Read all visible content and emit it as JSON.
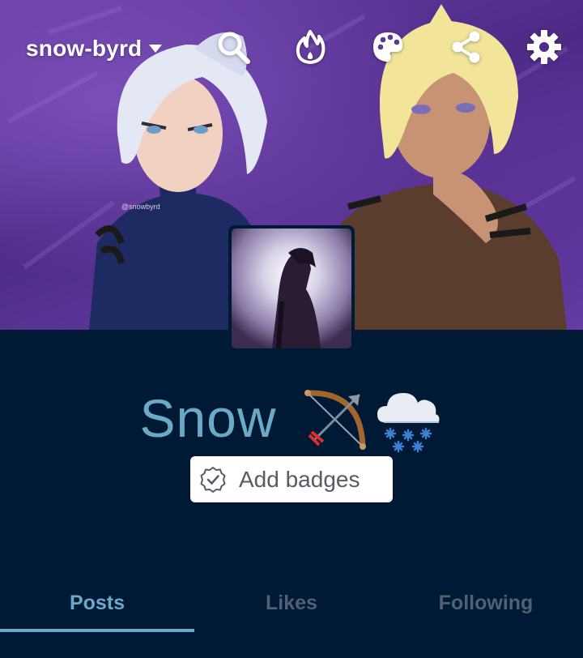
{
  "header": {
    "blog_name": "snow-byrd",
    "image_watermark": "@snowbyrd",
    "icons": [
      "chevron-down-icon",
      "search-icon",
      "flame-icon",
      "palette-icon",
      "share-icon",
      "gear-icon"
    ]
  },
  "blog": {
    "title": "Snow",
    "title_emoji": [
      "bow-and-arrow-emoji",
      "snow-cloud-emoji"
    ],
    "add_badges_label": "Add badges"
  },
  "tabs": [
    {
      "label": "Posts",
      "active": true
    },
    {
      "label": "Likes",
      "active": false
    },
    {
      "label": "Following",
      "active": false
    }
  ],
  "colors": {
    "background": "#001935",
    "accent": "#6aa9c8",
    "inactive_tab": "#4f6173",
    "button_bg": "#ffffff"
  }
}
